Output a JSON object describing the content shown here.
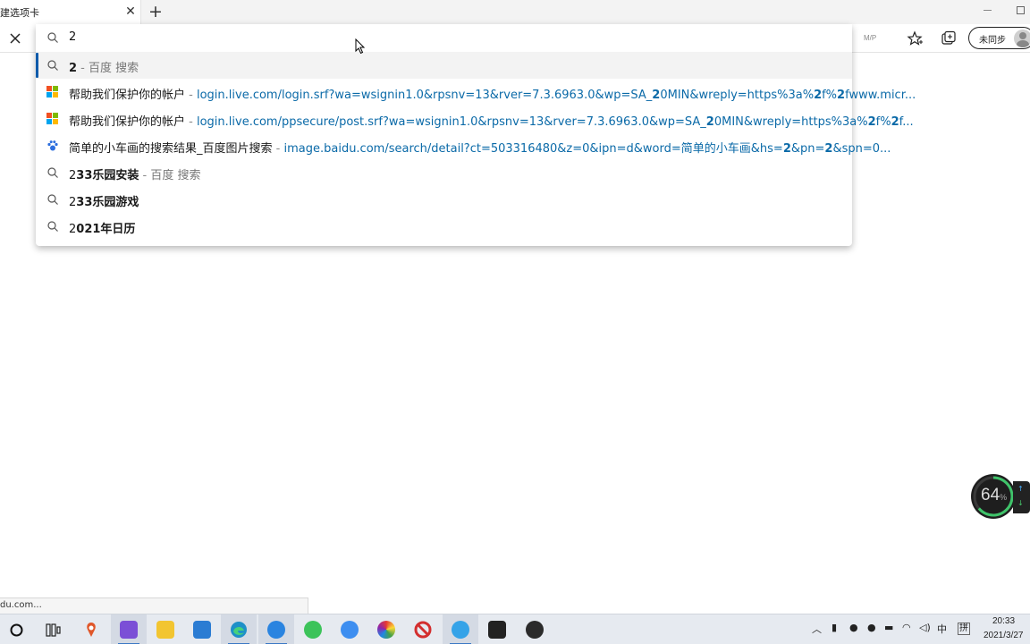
{
  "tab": {
    "title": "建选项卡"
  },
  "toolbar": {
    "extension_label": "M/P",
    "sync_label": "未同步"
  },
  "omnibox": {
    "input_value": "2",
    "suggestions": [
      {
        "type": "search",
        "icon": "search-icon",
        "query_bold": "2",
        "query_rest": "",
        "separator": " - ",
        "provider": "百度 搜索"
      },
      {
        "type": "history",
        "icon": "microsoft-logo-icon",
        "title": "帮助我们保护你的帐户",
        "separator": " - ",
        "url_before": "login.live.com/login.srf?wa=wsignin1.0&rpsnv=13&rver=7.3.6963.0&wp=SA_",
        "url_bold": "2",
        "url_after": "0MIN&wreply=https%3a%",
        "url_bold2": "2",
        "url_mid": "f%",
        "url_bold3": "2",
        "url_end": "fwww.micr..."
      },
      {
        "type": "history",
        "icon": "microsoft-logo-icon",
        "title": "帮助我们保护你的帐户",
        "separator": " - ",
        "url_before": "login.live.com/ppsecure/post.srf?wa=wsignin1.0&rpsnv=13&rver=7.3.6963.0&wp=SA_",
        "url_bold": "2",
        "url_after": "0MIN&wreply=https%3a%",
        "url_bold2": "2",
        "url_mid": "f%",
        "url_bold3": "2",
        "url_end": "f..."
      },
      {
        "type": "history",
        "icon": "baidu-paw-icon",
        "title": "简单的小车画的搜索结果_百度图片搜索",
        "separator": " - ",
        "url_before": "image.baidu.com/search/detail?ct=503316480&z=0&ipn=d&word=简单的小车画&hs=",
        "url_bold": "2",
        "url_after": "&pn=",
        "url_bold2": "2",
        "url_mid": "&spn=0...",
        "url_bold3": "",
        "url_end": ""
      },
      {
        "type": "search",
        "icon": "search-icon",
        "query_bold": "2",
        "query_rest": "33乐园安装",
        "separator": " - ",
        "provider": "百度 搜索"
      },
      {
        "type": "search",
        "icon": "search-icon",
        "query_bold": "2",
        "query_rest": "33乐园游戏",
        "separator": "",
        "provider": ""
      },
      {
        "type": "search",
        "icon": "search-icon",
        "query_bold": "2",
        "query_rest": "021年日历",
        "separator": "",
        "provider": ""
      }
    ]
  },
  "perf_widget": {
    "value": "64",
    "unit": "%",
    "level": 0.64
  },
  "status_bar": {
    "text": "du.com..."
  },
  "taskbar": {
    "tray_ime_lang": "中",
    "tray_ime_mode": "拼",
    "clock_time": "20:33",
    "clock_date": "2021/3/27"
  },
  "colors": {
    "url": "#0b6aa8",
    "selection_bar": "#0f5bab",
    "taskbar_bg": "#e6eaf0"
  }
}
